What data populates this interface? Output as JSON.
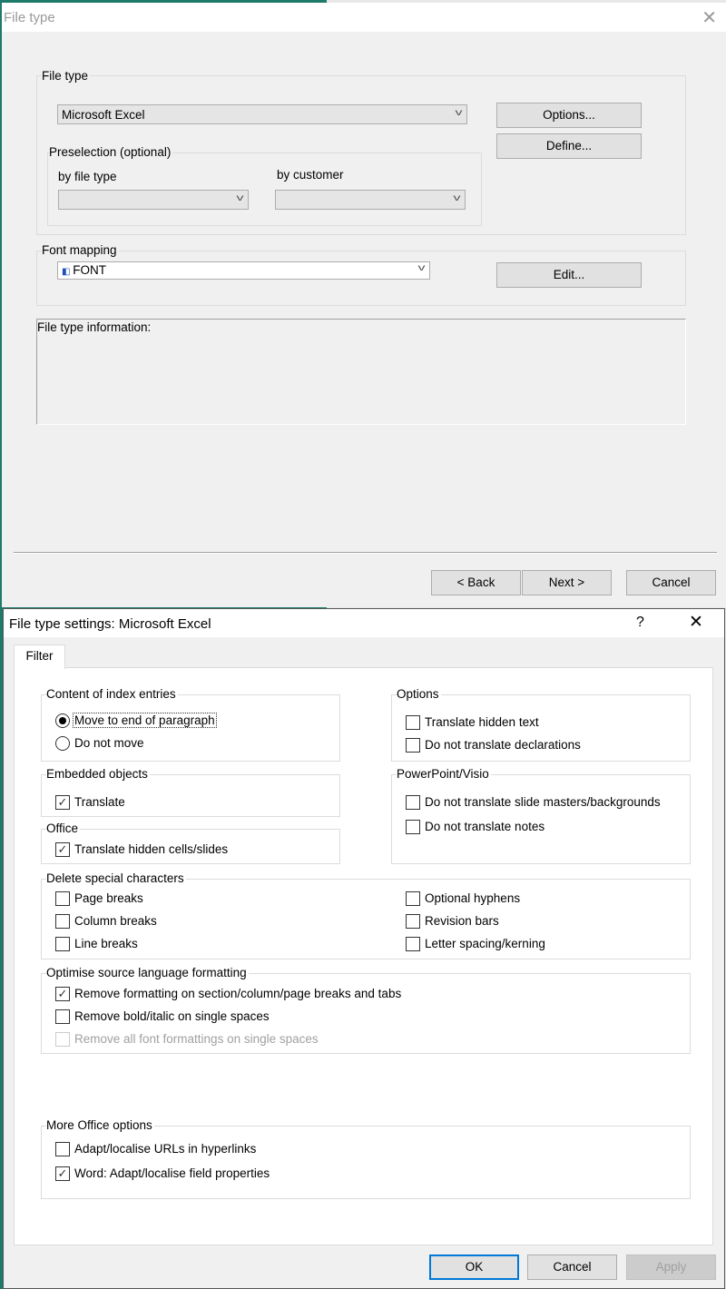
{
  "dialog1": {
    "title": "File type",
    "close_icon": "close-icon",
    "file_type_group": "File type",
    "file_type_value": "Microsoft Excel",
    "options_button": "Options...",
    "define_button": "Define...",
    "preselection_group": "Preselection (optional)",
    "by_file_type_label": "by file type",
    "by_file_type_value": "",
    "by_customer_label": "by customer",
    "by_customer_value": "",
    "font_mapping_group": "Font mapping",
    "font_mapping_value": "FONT",
    "edit_button": "Edit...",
    "info_label": "File type information:",
    "back_button": "< Back",
    "next_button": "Next >",
    "cancel_button": "Cancel"
  },
  "dialog2": {
    "title": "File type settings: Microsoft Excel",
    "help": "?",
    "tab": "Filter",
    "index_group": "Content of index entries",
    "index_options": [
      {
        "label": "Move to end of paragraph",
        "selected": true
      },
      {
        "label": "Do not move",
        "selected": false
      }
    ],
    "embedded_group": "Embedded objects",
    "embedded_translate": {
      "label": "Translate",
      "checked": true
    },
    "office_group": "Office",
    "office_hidden": {
      "label": "Translate hidden cells/slides",
      "checked": true
    },
    "options_group": "Options",
    "options_items": [
      {
        "label": "Translate hidden text",
        "checked": false
      },
      {
        "label": "Do not translate declarations",
        "checked": false
      }
    ],
    "ppt_group": "PowerPoint/Visio",
    "ppt_items": [
      {
        "label": "Do not translate slide masters/backgrounds",
        "checked": false
      },
      {
        "label": "Do not translate notes",
        "checked": false
      }
    ],
    "delete_group": "Delete special characters",
    "delete_items": [
      {
        "label": "Page breaks",
        "checked": false
      },
      {
        "label": "Column breaks",
        "checked": false
      },
      {
        "label": "Line breaks",
        "checked": false
      },
      {
        "label": "Optional hyphens",
        "checked": false
      },
      {
        "label": "Revision bars",
        "checked": false
      },
      {
        "label": "Letter spacing/kerning",
        "checked": false
      }
    ],
    "optimise_group": "Optimise source language formatting",
    "optimise_items": [
      {
        "label": "Remove formatting on section/column/page breaks and tabs",
        "checked": true
      },
      {
        "label": "Remove bold/italic on single spaces",
        "checked": false
      },
      {
        "label": "Remove all font formattings on single spaces",
        "checked": false,
        "disabled": true
      }
    ],
    "more_group": "More Office options",
    "more_items": [
      {
        "label": "Adapt/localise URLs in hyperlinks",
        "checked": false
      },
      {
        "label": "Word: Adapt/localise field properties",
        "checked": true
      }
    ],
    "ok_button": "OK",
    "cancel_button": "Cancel",
    "apply_button": "Apply"
  }
}
